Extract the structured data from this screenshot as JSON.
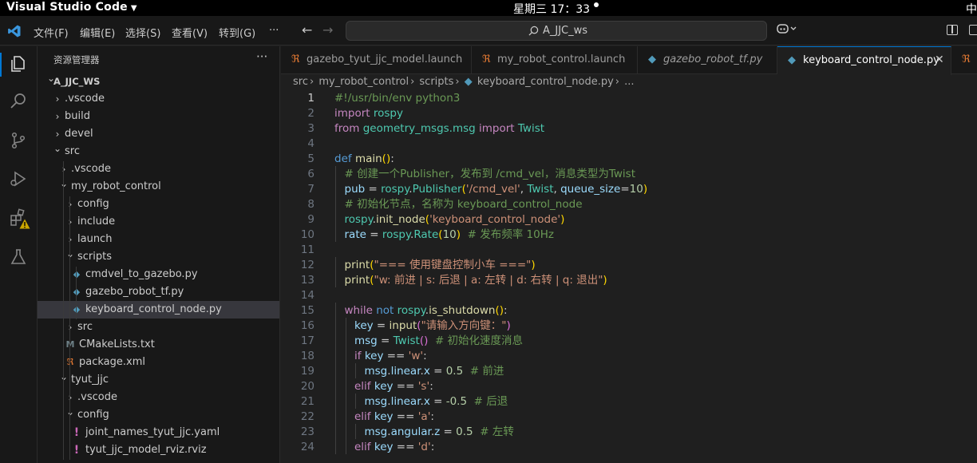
{
  "system_bar": {
    "app_name": "Visual Studio Code",
    "clock": "星期三 17：33",
    "ime": "中"
  },
  "menu": [
    "文件(F)",
    "编辑(E)",
    "选择(S)",
    "查看(V)",
    "转到(G)",
    "···"
  ],
  "search": {
    "text": "A_JJC_ws"
  },
  "sidebar": {
    "title": "资源管理器",
    "more": "···",
    "tree": [
      {
        "label": "A_JJC_WS",
        "depth": 0,
        "kind": "root-open"
      },
      {
        "label": ".vscode",
        "depth": 1,
        "kind": "folder"
      },
      {
        "label": "build",
        "depth": 1,
        "kind": "folder"
      },
      {
        "label": "devel",
        "depth": 1,
        "kind": "folder"
      },
      {
        "label": "src",
        "depth": 1,
        "kind": "folder-open"
      },
      {
        "label": ".vscode",
        "depth": 2,
        "kind": "folder"
      },
      {
        "label": "my_robot_control",
        "depth": 2,
        "kind": "folder-open"
      },
      {
        "label": "config",
        "depth": 3,
        "kind": "folder"
      },
      {
        "label": "include",
        "depth": 3,
        "kind": "folder"
      },
      {
        "label": "launch",
        "depth": 3,
        "kind": "folder"
      },
      {
        "label": "scripts",
        "depth": 3,
        "kind": "folder-open"
      },
      {
        "label": "cmdvel_to_gazebo.py",
        "depth": 4,
        "kind": "py"
      },
      {
        "label": "gazebo_robot_tf.py",
        "depth": 4,
        "kind": "py"
      },
      {
        "label": "keyboard_control_node.py",
        "depth": 4,
        "kind": "py",
        "selected": true
      },
      {
        "label": "src",
        "depth": 3,
        "kind": "folder"
      },
      {
        "label": "CMakeLists.txt",
        "depth": 3,
        "kind": "cmake"
      },
      {
        "label": "package.xml",
        "depth": 3,
        "kind": "xml"
      },
      {
        "label": "tyut_jjc",
        "depth": 2,
        "kind": "folder-open"
      },
      {
        "label": ".vscode",
        "depth": 3,
        "kind": "folder"
      },
      {
        "label": "config",
        "depth": 3,
        "kind": "folder-open"
      },
      {
        "label": "joint_names_tyut_jjc.yaml",
        "depth": 4,
        "kind": "yaml"
      },
      {
        "label": "tyut_jjc_model_rviz.rviz",
        "depth": 4,
        "kind": "yaml"
      }
    ]
  },
  "tabs": [
    {
      "label": "gazebo_tyut_jjc_model.launch",
      "icon": "rss-icon",
      "italic": false,
      "active": false
    },
    {
      "label": "my_robot_control.launch",
      "icon": "rss-icon",
      "italic": false,
      "active": false
    },
    {
      "label": "gazebo_robot_tf.py",
      "icon": "python-icon",
      "italic": true,
      "active": false
    },
    {
      "label": "keyboard_control_node.py",
      "icon": "python-icon",
      "italic": false,
      "active": true,
      "close": "✕"
    }
  ],
  "breadcrumb": [
    "src",
    "my_robot_control",
    "scripts",
    "keyboard_control_node.py",
    "..."
  ],
  "code_lines": [
    {
      "n": "1",
      "indent": 0,
      "tokens": [
        [
          "sh",
          "#!/usr/bin/env python3"
        ]
      ]
    },
    {
      "n": "2",
      "indent": 0,
      "tokens": [
        [
          "kc",
          "import"
        ],
        [
          "",
          " "
        ],
        [
          "t",
          "rospy"
        ]
      ]
    },
    {
      "n": "3",
      "indent": 0,
      "tokens": [
        [
          "kc",
          "from"
        ],
        [
          "",
          " "
        ],
        [
          "t",
          "geometry_msgs.msg"
        ],
        [
          "",
          " "
        ],
        [
          "kc",
          "import"
        ],
        [
          "",
          " "
        ],
        [
          "t",
          "Twist"
        ]
      ]
    },
    {
      "n": "4",
      "indent": 0,
      "tokens": []
    },
    {
      "n": "5",
      "indent": 0,
      "tokens": [
        [
          "k",
          "def"
        ],
        [
          "",
          " "
        ],
        [
          "f",
          "main"
        ],
        [
          "p",
          "()"
        ],
        [
          "",
          ":"
        ]
      ]
    },
    {
      "n": "6",
      "indent": 1,
      "tokens": [
        [
          "c",
          "# 创建一个Publisher，发布到 /cmd_vel，消息类型为Twist"
        ]
      ]
    },
    {
      "n": "7",
      "indent": 1,
      "tokens": [
        [
          "v",
          "pub"
        ],
        [
          "",
          " = "
        ],
        [
          "t",
          "rospy"
        ],
        [
          "",
          "."
        ],
        [
          "t",
          "Publisher"
        ],
        [
          "p",
          "("
        ],
        [
          "s",
          "'/cmd_vel'"
        ],
        [
          "",
          ", "
        ],
        [
          "t",
          "Twist"
        ],
        [
          "",
          ", "
        ],
        [
          "v",
          "queue_size"
        ],
        [
          "",
          "="
        ],
        [
          "n",
          "10"
        ],
        [
          "p",
          ")"
        ]
      ]
    },
    {
      "n": "8",
      "indent": 1,
      "tokens": [
        [
          "c",
          "# 初始化节点，名称为 keyboard_control_node"
        ]
      ]
    },
    {
      "n": "9",
      "indent": 1,
      "tokens": [
        [
          "t",
          "rospy"
        ],
        [
          "",
          "."
        ],
        [
          "f",
          "init_node"
        ],
        [
          "p",
          "("
        ],
        [
          "s",
          "'keyboard_control_node'"
        ],
        [
          "p",
          ")"
        ]
      ]
    },
    {
      "n": "10",
      "indent": 1,
      "tokens": [
        [
          "v",
          "rate"
        ],
        [
          "",
          " = "
        ],
        [
          "t",
          "rospy"
        ],
        [
          "",
          "."
        ],
        [
          "t",
          "Rate"
        ],
        [
          "p",
          "("
        ],
        [
          "n",
          "10"
        ],
        [
          "p",
          ")"
        ],
        [
          "",
          "  "
        ],
        [
          "c",
          "# 发布频率 10Hz"
        ]
      ]
    },
    {
      "n": "11",
      "indent": 0,
      "tokens": []
    },
    {
      "n": "12",
      "indent": 1,
      "tokens": [
        [
          "f",
          "print"
        ],
        [
          "p",
          "("
        ],
        [
          "s",
          "\"=== 使用键盘控制小车 ===\""
        ],
        [
          "p",
          ")"
        ]
      ]
    },
    {
      "n": "13",
      "indent": 1,
      "tokens": [
        [
          "f",
          "print"
        ],
        [
          "p",
          "("
        ],
        [
          "s",
          "\"w: 前进 | s: 后退 | a: 左转 | d: 右转 | q: 退出\""
        ],
        [
          "p",
          ")"
        ]
      ]
    },
    {
      "n": "14",
      "indent": 0,
      "tokens": []
    },
    {
      "n": "15",
      "indent": 1,
      "tokens": [
        [
          "kc",
          "while"
        ],
        [
          "",
          " "
        ],
        [
          "k",
          "not"
        ],
        [
          "",
          " "
        ],
        [
          "t",
          "rospy"
        ],
        [
          "",
          "."
        ],
        [
          "f",
          "is_shutdown"
        ],
        [
          "p",
          "()"
        ],
        [
          "",
          ":"
        ]
      ]
    },
    {
      "n": "16",
      "indent": 2,
      "tokens": [
        [
          "v",
          "key"
        ],
        [
          "",
          " = "
        ],
        [
          "f",
          "input"
        ],
        [
          "p2",
          "("
        ],
        [
          "s",
          "\"请输入方向键：\""
        ],
        [
          "p2",
          ")"
        ]
      ]
    },
    {
      "n": "17",
      "indent": 2,
      "tokens": [
        [
          "v",
          "msg"
        ],
        [
          "",
          " = "
        ],
        [
          "t",
          "Twist"
        ],
        [
          "p2",
          "()"
        ],
        [
          "",
          "  "
        ],
        [
          "c",
          "# 初始化速度消息"
        ]
      ]
    },
    {
      "n": "18",
      "indent": 2,
      "tokens": [
        [
          "kc",
          "if"
        ],
        [
          "",
          " "
        ],
        [
          "v",
          "key"
        ],
        [
          "",
          " == "
        ],
        [
          "s",
          "'w'"
        ],
        [
          "",
          ":"
        ]
      ]
    },
    {
      "n": "19",
      "indent": 3,
      "tokens": [
        [
          "v",
          "msg"
        ],
        [
          "",
          "."
        ],
        [
          "v",
          "linear"
        ],
        [
          "",
          "."
        ],
        [
          "v",
          "x"
        ],
        [
          "",
          " = "
        ],
        [
          "n",
          "0.5"
        ],
        [
          "",
          "  "
        ],
        [
          "c",
          "# 前进"
        ]
      ]
    },
    {
      "n": "20",
      "indent": 2,
      "tokens": [
        [
          "kc",
          "elif"
        ],
        [
          "",
          " "
        ],
        [
          "v",
          "key"
        ],
        [
          "",
          " == "
        ],
        [
          "s",
          "'s'"
        ],
        [
          "",
          ":"
        ]
      ]
    },
    {
      "n": "21",
      "indent": 3,
      "tokens": [
        [
          "v",
          "msg"
        ],
        [
          "",
          "."
        ],
        [
          "v",
          "linear"
        ],
        [
          "",
          "."
        ],
        [
          "v",
          "x"
        ],
        [
          "",
          " = "
        ],
        [
          "n",
          "-0.5"
        ],
        [
          "",
          "  "
        ],
        [
          "c",
          "# 后退"
        ]
      ]
    },
    {
      "n": "22",
      "indent": 2,
      "tokens": [
        [
          "kc",
          "elif"
        ],
        [
          "",
          " "
        ],
        [
          "v",
          "key"
        ],
        [
          "",
          " == "
        ],
        [
          "s",
          "'a'"
        ],
        [
          "",
          ":"
        ]
      ]
    },
    {
      "n": "23",
      "indent": 3,
      "tokens": [
        [
          "v",
          "msg"
        ],
        [
          "",
          "."
        ],
        [
          "v",
          "angular"
        ],
        [
          "",
          "."
        ],
        [
          "v",
          "z"
        ],
        [
          "",
          " = "
        ],
        [
          "n",
          "0.5"
        ],
        [
          "",
          "  "
        ],
        [
          "c",
          "# 左转"
        ]
      ]
    },
    {
      "n": "24",
      "indent": 2,
      "tokens": [
        [
          "kc",
          "elif"
        ],
        [
          "",
          " "
        ],
        [
          "v",
          "key"
        ],
        [
          "",
          " == "
        ],
        [
          "s",
          "'d'"
        ],
        [
          "",
          ":"
        ]
      ]
    }
  ],
  "colors": {
    "accent": "#0078d4",
    "background": "#1f1f1f",
    "sidebar": "#181818",
    "selection": "#37373d",
    "warning_badge": "#cca700"
  }
}
